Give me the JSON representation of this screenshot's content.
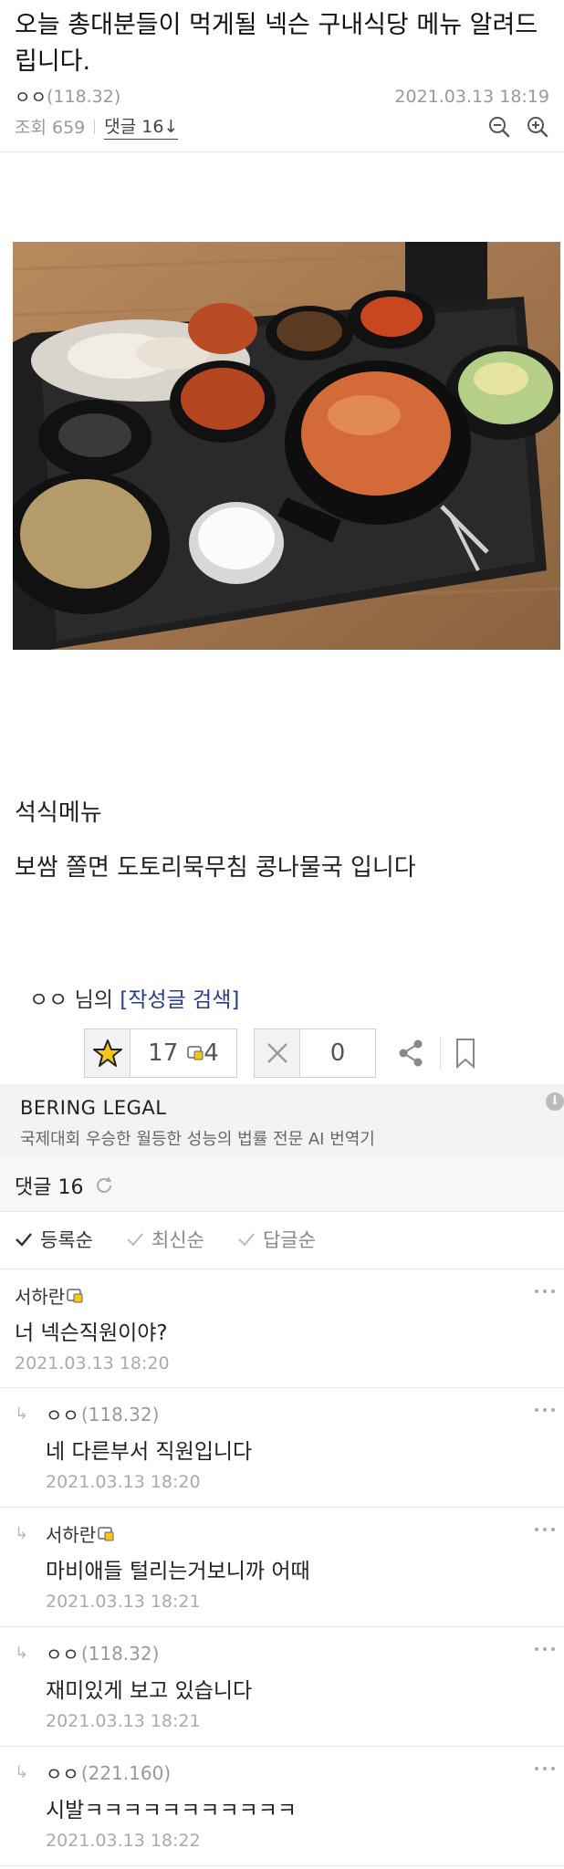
{
  "post": {
    "title": "오늘 총대분들이 먹게될 넥슨 구내식당 메뉴 알려드립니다.",
    "author": "ㅇㅇ",
    "author_ip": "(118.32)",
    "datetime": "2021.03.13 18:19",
    "views": "조회 659",
    "replies_link": "댓글 16↓",
    "body_line1": "석식메뉴",
    "body_line2": "보쌈 쫄면 도토리묵무침 콩나물국 입니다",
    "author_search_prefix": "ㅇㅇ 님의 ",
    "author_search_link": "[작성글 검색]"
  },
  "votes": {
    "up_count": "17",
    "fixed_count": "4",
    "down_count": "0"
  },
  "ad": {
    "title": "BERING LEGAL",
    "description": "국제대회 우승한 월등한 성능의 법률 전문 AI 번역기",
    "info_glyph": "i"
  },
  "comments_header": {
    "label": "댓글 16"
  },
  "sort_options": [
    {
      "label": "등록순"
    },
    {
      "label": "최신순"
    },
    {
      "label": "답글순"
    }
  ],
  "comments": [
    {
      "nick": "서하란",
      "ip": "",
      "text": "너 넥슨직원이야?",
      "date": "2021.03.13 18:20",
      "reply": false,
      "fixed": true
    },
    {
      "nick": "ㅇㅇ",
      "ip": "(118.32)",
      "text": "네 다른부서 직원입니다",
      "date": "2021.03.13 18:20",
      "reply": true,
      "fixed": false
    },
    {
      "nick": "서하란",
      "ip": "",
      "text": "마비애들 털리는거보니까 어때",
      "date": "2021.03.13 18:21",
      "reply": true,
      "fixed": true
    },
    {
      "nick": "ㅇㅇ",
      "ip": "(118.32)",
      "text": "재미있게 보고 있습니다",
      "date": "2021.03.13 18:21",
      "reply": true,
      "fixed": false
    },
    {
      "nick": "ㅇㅇ",
      "ip": "(221.160)",
      "text": "시발ㅋㅋㅋㅋㅋㅋㅋㅋㅋㅋㅋ",
      "date": "2021.03.13 18:22",
      "reply": true,
      "fixed": false
    }
  ],
  "colors": {
    "link_blue": "#2b3a8c",
    "meta_gray": "#999999",
    "star_yellow": "#f5c518"
  }
}
